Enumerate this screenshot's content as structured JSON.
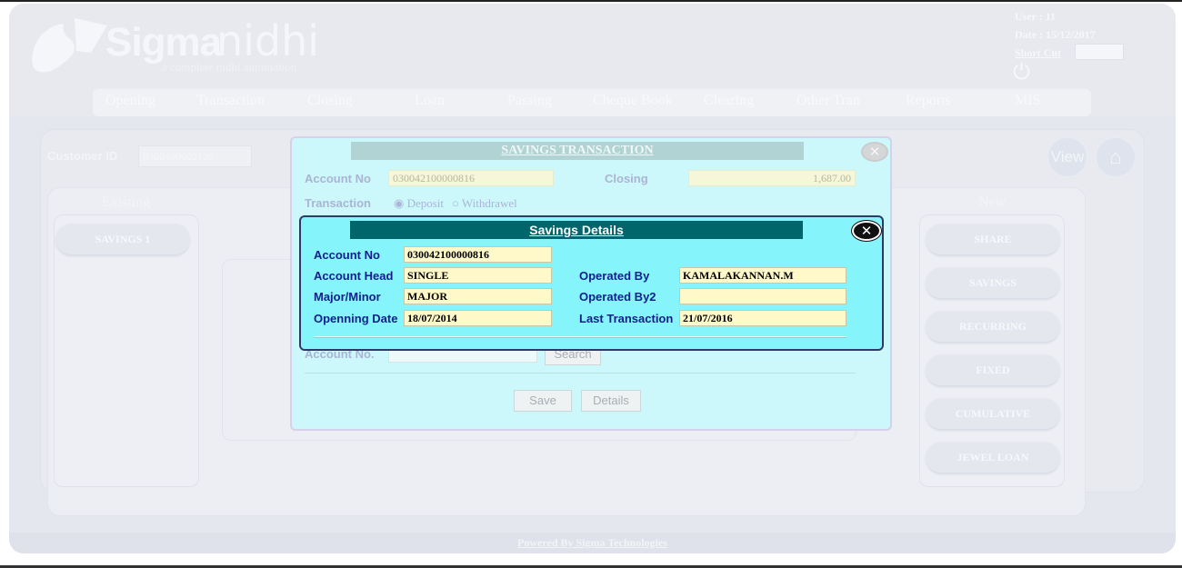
{
  "header": {
    "logo_sigma": "Sigma",
    "logo_nidhi": "nidhi",
    "logo_tagline": "a complete nidhi automation",
    "user_label": "User : 11",
    "date_label": "Date : 15/12/2017",
    "shortcut_label": "Short Cut",
    "shortcut_value": ""
  },
  "menu": [
    "Opening",
    "Transaction",
    "Closing",
    "Loan",
    "Passing",
    "Cheque Book",
    "Clearing",
    "Other Tran",
    "Reports",
    "MIS"
  ],
  "customer": {
    "label": "Customer ID",
    "value": "0300400002126",
    "view_button": "View"
  },
  "existing": {
    "title": "Existing",
    "items": [
      "SAVINGS 1"
    ]
  },
  "new_accounts": {
    "title": "New",
    "items": [
      "SHARE",
      "SAVINGS",
      "RECURRING",
      "FIXED",
      "CUMULATIVE",
      "JEWEL LOAN"
    ]
  },
  "savings_transaction": {
    "title": "SAVINGS TRANSACTION",
    "account_no_label": "Account No",
    "account_no_value": "030042100000816",
    "closing_label": "Closing",
    "closing_value": "1,687.00",
    "transaction_label": "Transaction",
    "deposit_label": "Deposit",
    "withdrawel_label": "Withdrawel",
    "account_no2_label": "Account No.",
    "search_button": "Search",
    "save_button": "Save",
    "details_button": "Details"
  },
  "savings_details": {
    "title": "Savings Details",
    "account_no_label": "Account No",
    "account_no_value": "030042100000816",
    "account_head_label": "Account Head",
    "account_head_value": "SINGLE",
    "major_minor_label": "Major/Minor",
    "major_minor_value": "MAJOR",
    "opening_date_label": "Openning Date",
    "opening_date_value": "18/07/2014",
    "operated_by_label": "Operated By",
    "operated_by_value": "KAMALAKANNAN.M",
    "operated_by2_label": "Operated By2",
    "operated_by2_value": "",
    "last_transaction_label": "Last Transaction",
    "last_transaction_value": "21/07/2016"
  },
  "footer": {
    "text": "Powered By Sigma Technologies"
  },
  "icons": {
    "close": "close-icon",
    "power": "power-icon",
    "home": "home-icon"
  }
}
